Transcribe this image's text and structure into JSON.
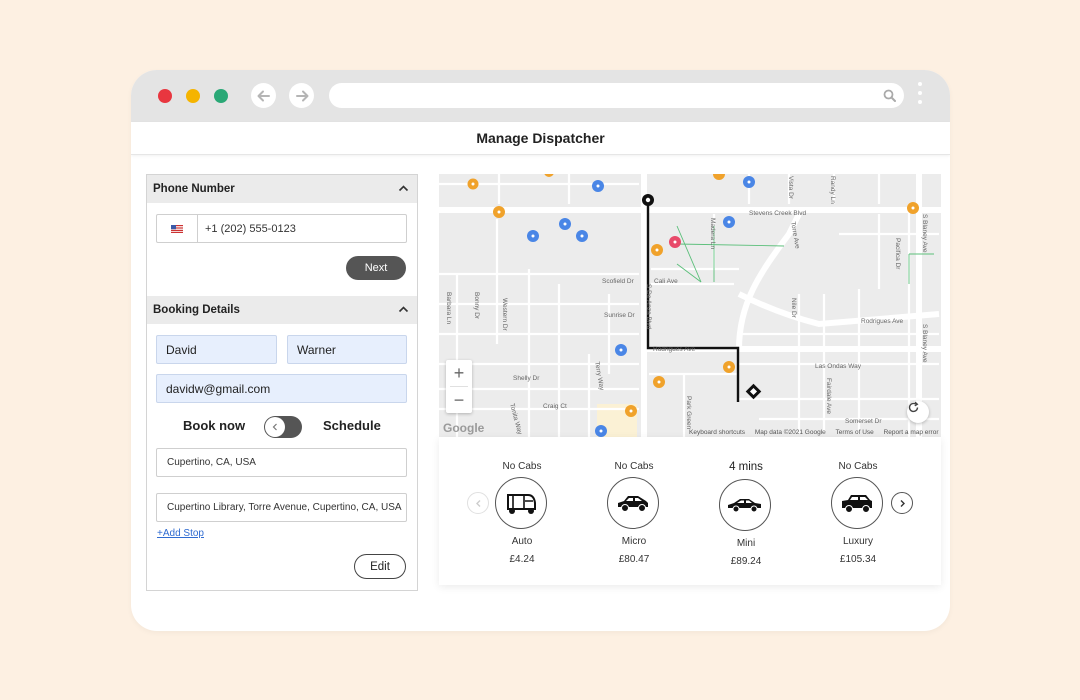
{
  "page_title": "Manage Dispatcher",
  "colors": {
    "background": "#fdf0e2",
    "close_dot": "#e8363f",
    "minimize_dot": "#f5b400",
    "maximize_dot": "#2aa876",
    "button_dark": "#555555",
    "field_highlight": "#e7effd",
    "link": "#2f6bd1"
  },
  "phone_section": {
    "title": "Phone Number",
    "flag_icon": "us-flag-icon",
    "phone": "+1 (202) 555-0123",
    "next_label": "Next"
  },
  "booking_section": {
    "title": "Booking Details",
    "first_name": "David",
    "last_name": "Warner",
    "email": "davidw@gmail.com",
    "book_now_label": "Book now",
    "schedule_label": "Schedule",
    "pickup": "Cupertino, CA, USA",
    "dropoff": "Cupertino Library, Torre Avenue, Cupertino, CA, USA",
    "add_stop_label": "+Add Stop",
    "edit_label": "Edit"
  },
  "map": {
    "streets": {
      "stevens_creek": "Stevens Creek Blvd",
      "torre": "Torre Ave",
      "de_anza": "S De Anza Blvd",
      "rodrigues": "Rodrigues Ave",
      "rodrigues2": "Rodrigues Ave",
      "blaney1": "S Blaney Ave",
      "blaney2": "S Blaney Ave",
      "cali": "Cali Ave",
      "scofield": "Scofield Dr",
      "sunrise": "Sunrise Dr",
      "shelly": "Shelly Dr",
      "craig": "Craig Ct",
      "las_ondas": "Las Ondas Way",
      "somerset": "Somerset Dr",
      "bonny": "Bonny Dr",
      "western": "Western Dr",
      "terry": "Terry Way",
      "tonita": "Tonita Way",
      "barbara": "Barbara Ln",
      "park_green": "Park Green",
      "fairdale": "Fairdale Ave",
      "nile": "Nile Dr",
      "vista": "Vista Dr",
      "randy": "Randy Ln",
      "mcclellan": "Pacifica Dr",
      "madera": "Madera Ln"
    },
    "attribution": {
      "shortcuts": "Keyboard shortcuts",
      "data": "Map data ©2021 Google",
      "terms": "Terms of Use",
      "report": "Report a map error"
    },
    "watermark": "Google"
  },
  "cabs": [
    {
      "status": "No Cabs",
      "name": "Auto",
      "price": "£4.24",
      "icon": "auto-rickshaw-icon"
    },
    {
      "status": "No Cabs",
      "name": "Micro",
      "price": "£80.47",
      "icon": "hatchback-car-icon"
    },
    {
      "status": "4 mins",
      "name": "Mini",
      "price": "£89.24",
      "icon": "sedan-car-icon"
    },
    {
      "status": "No Cabs",
      "name": "Luxury",
      "price": "£105.34",
      "icon": "suv-car-icon"
    }
  ]
}
